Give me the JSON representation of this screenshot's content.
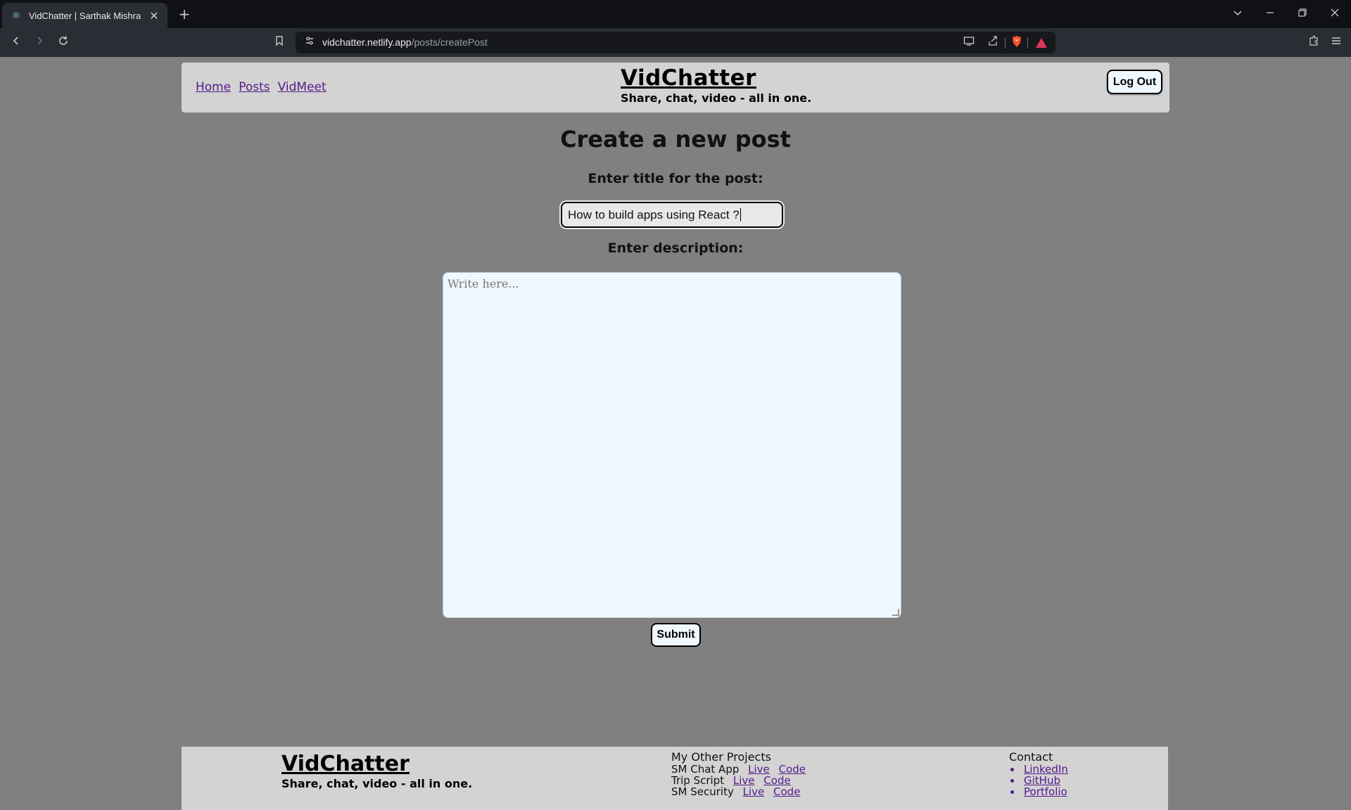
{
  "browser": {
    "tab_title": "VidChatter | Sarthak Mishra",
    "url_host": "vidchatter.netlify.app",
    "url_path": "/posts/createPost"
  },
  "header": {
    "nav": [
      "Home",
      "Posts",
      "VidMeet"
    ],
    "brand_title": "VidChatter",
    "brand_tagline": "Share, chat, video - all in one.",
    "logout_label": "Log Out"
  },
  "form": {
    "heading": "Create a new post",
    "title_label": "Enter title for the post:",
    "title_value": "How to build apps using React ?",
    "description_label": "Enter description:",
    "description_placeholder": "Write here...",
    "submit_label": "Submit"
  },
  "footer": {
    "brand_title": "VidChatter",
    "brand_tagline": "Share, chat, video - all in one.",
    "projects_heading": "My Other Projects",
    "projects": [
      {
        "name": "SM Chat App",
        "live": "Live",
        "code": "Code"
      },
      {
        "name": "Trip Script",
        "live": "Live",
        "code": "Code"
      },
      {
        "name": "SM Security",
        "live": "Live",
        "code": "Code"
      }
    ],
    "contact_heading": "Contact",
    "contact_links": [
      "LinkedIn",
      "GitHub",
      "Portfolio"
    ]
  },
  "colors": {
    "page_bg": "#808080",
    "header_bg": "#d3d3d3",
    "link": "#551a8b",
    "button_bg": "#f0f8ff"
  },
  "icons": [
    "react-favicon-icon",
    "close-icon",
    "plus-icon",
    "chevron-down-icon",
    "minimize-icon",
    "restore-icon",
    "close-window-icon",
    "back-icon",
    "forward-icon",
    "reload-icon",
    "bookmark-icon",
    "site-info-icon",
    "cast-icon",
    "share-icon",
    "brave-shield-icon",
    "brave-rewards-icon",
    "extensions-icon",
    "menu-icon"
  ]
}
